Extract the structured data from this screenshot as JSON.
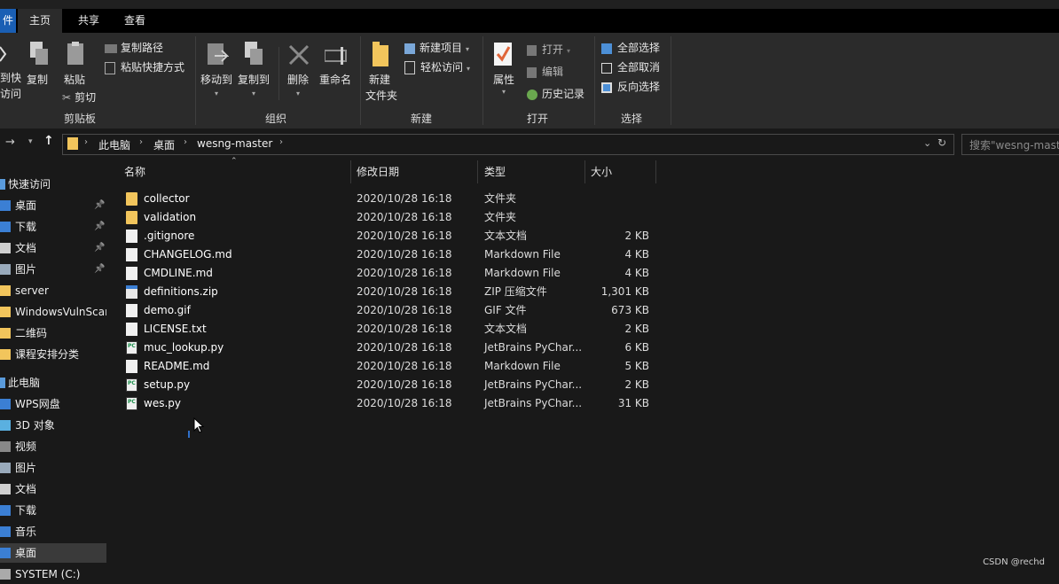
{
  "tabs": {
    "file": "件",
    "home": "主页",
    "share": "共享",
    "view": "查看"
  },
  "ribbon": {
    "clipboard": {
      "pin_label_1": "到快",
      "pin_label_2": "访问",
      "copy": "复制",
      "paste": "粘贴",
      "copy_path": "复制路径",
      "paste_shortcut": "粘贴快捷方式",
      "cut": "剪切",
      "group": "剪贴板"
    },
    "organize": {
      "move_to": "移动到",
      "copy_to": "复制到",
      "delete": "删除",
      "rename": "重命名",
      "group": "组织"
    },
    "new": {
      "new_folder_1": "新建",
      "new_folder_2": "文件夹",
      "new_item": "新建项目",
      "easy_access": "轻松访问",
      "group": "新建"
    },
    "open": {
      "properties": "属性",
      "open": "打开",
      "edit": "编辑",
      "history": "历史记录",
      "group": "打开"
    },
    "select": {
      "select_all": "全部选择",
      "select_none": "全部取消",
      "invert": "反向选择",
      "group": "选择"
    }
  },
  "address": {
    "crumbs": [
      "此电脑",
      "桌面",
      "wesng-master"
    ],
    "search_placeholder": "搜索\"wesng-mast"
  },
  "nav": {
    "items": [
      {
        "label": "快速访问",
        "icon": "star-icon",
        "pinned": false
      },
      {
        "label": "桌面",
        "icon": "desktop-icon",
        "pinned": true
      },
      {
        "label": "下载",
        "icon": "download-icon",
        "pinned": true
      },
      {
        "label": "文档",
        "icon": "document-icon",
        "pinned": true
      },
      {
        "label": "图片",
        "icon": "picture-icon",
        "pinned": true
      },
      {
        "label": "server",
        "icon": "folder-icon",
        "pinned": false
      },
      {
        "label": "WindowsVulnScan",
        "icon": "folder-icon",
        "pinned": false
      },
      {
        "label": "二维码",
        "icon": "folder-icon",
        "pinned": false
      },
      {
        "label": "课程安排分类",
        "icon": "folder-icon",
        "pinned": false
      },
      {
        "label": "此电脑",
        "icon": "computer-icon",
        "pinned": false
      },
      {
        "label": "WPS网盘",
        "icon": "cloud-icon",
        "pinned": false
      },
      {
        "label": "3D 对象",
        "icon": "cube-icon",
        "pinned": false
      },
      {
        "label": "视频",
        "icon": "video-icon",
        "pinned": false
      },
      {
        "label": "图片",
        "icon": "picture-icon",
        "pinned": false
      },
      {
        "label": "文档",
        "icon": "document-icon",
        "pinned": false
      },
      {
        "label": "下载",
        "icon": "download-icon",
        "pinned": false
      },
      {
        "label": "音乐",
        "icon": "music-icon",
        "pinned": false
      },
      {
        "label": "桌面",
        "icon": "desktop-icon",
        "pinned": false
      },
      {
        "label": "SYSTEM (C:)",
        "icon": "drive-icon",
        "pinned": false
      }
    ]
  },
  "columns": {
    "name": "名称",
    "date": "修改日期",
    "type": "类型",
    "size": "大小"
  },
  "files": [
    {
      "name": "collector",
      "date": "2020/10/28 16:18",
      "type": "文件夹",
      "size": "",
      "icon": "folder"
    },
    {
      "name": "validation",
      "date": "2020/10/28 16:18",
      "type": "文件夹",
      "size": "",
      "icon": "folder"
    },
    {
      "name": ".gitignore",
      "date": "2020/10/28 16:18",
      "type": "文本文档",
      "size": "2 KB",
      "icon": "doc"
    },
    {
      "name": "CHANGELOG.md",
      "date": "2020/10/28 16:18",
      "type": "Markdown File",
      "size": "4 KB",
      "icon": "doc"
    },
    {
      "name": "CMDLINE.md",
      "date": "2020/10/28 16:18",
      "type": "Markdown File",
      "size": "4 KB",
      "icon": "doc"
    },
    {
      "name": "definitions.zip",
      "date": "2020/10/28 16:18",
      "type": "ZIP 压缩文件",
      "size": "1,301 KB",
      "icon": "zip"
    },
    {
      "name": "demo.gif",
      "date": "2020/10/28 16:18",
      "type": "GIF 文件",
      "size": "673 KB",
      "icon": "doc"
    },
    {
      "name": "LICENSE.txt",
      "date": "2020/10/28 16:18",
      "type": "文本文档",
      "size": "2 KB",
      "icon": "doc"
    },
    {
      "name": "muc_lookup.py",
      "date": "2020/10/28 16:18",
      "type": "JetBrains PyChar...",
      "size": "6 KB",
      "icon": "py"
    },
    {
      "name": "README.md",
      "date": "2020/10/28 16:18",
      "type": "Markdown File",
      "size": "5 KB",
      "icon": "doc"
    },
    {
      "name": "setup.py",
      "date": "2020/10/28 16:18",
      "type": "JetBrains PyChar...",
      "size": "2 KB",
      "icon": "py"
    },
    {
      "name": "wes.py",
      "date": "2020/10/28 16:18",
      "type": "JetBrains PyChar...",
      "size": "31 KB",
      "icon": "py"
    }
  ],
  "watermark": "CSDN @rechd",
  "colors": {
    "folder": "#f2c55c",
    "accent": "#1a5fb4",
    "background": "#191919",
    "ribbon": "#2b2b2b"
  }
}
